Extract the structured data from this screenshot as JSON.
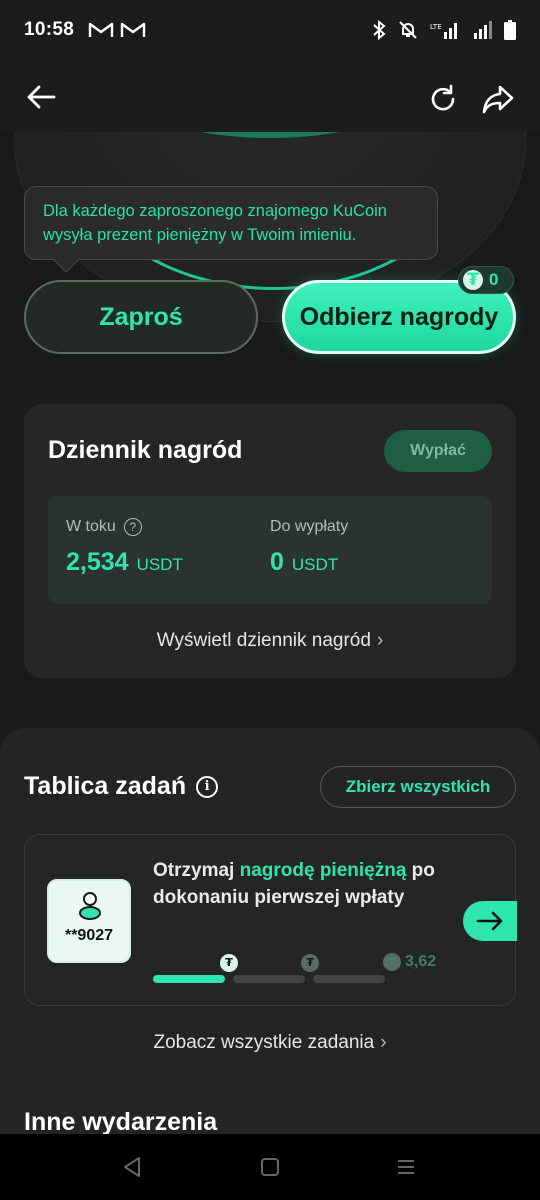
{
  "status_bar": {
    "time": "10:58",
    "net_label": "LTE"
  },
  "tooltip": {
    "text": "Dla każdego zaproszonego znajomego KuCoin wysyła prezent pieniężny w Twoim imieniu."
  },
  "actions": {
    "invite_label": "Zaproś",
    "claim_label": "Odbierz nagrody",
    "claim_badge_count": "0"
  },
  "reward_log": {
    "title": "Dziennik nagród",
    "withdraw_label": "Wypłać",
    "in_progress_label": "W toku",
    "in_progress_value": "2,534",
    "in_progress_unit": "USDT",
    "payable_label": "Do wypłaty",
    "payable_value": "0",
    "payable_unit": "USDT",
    "view_link": "Wyświetl dziennik nagród"
  },
  "tasks": {
    "title": "Tablica zadań",
    "collect_all_label": "Zbierz wszystkich",
    "task": {
      "user": "**9027",
      "text_before": "Otrzymaj ",
      "text_highlight": "nagrodę pieniężną",
      "text_after": " po dokonaniu pierwszej wpłaty",
      "reward_amount": "3,62",
      "progress_steps_done": 1,
      "progress_steps_total": 3
    },
    "view_all_link": "Zobacz wszystkie zadania"
  },
  "other_events": {
    "title": "Inne wydarzenia"
  },
  "colors": {
    "accent": "#2ee6ad",
    "background": "#1a1a1a",
    "card": "#262626"
  }
}
